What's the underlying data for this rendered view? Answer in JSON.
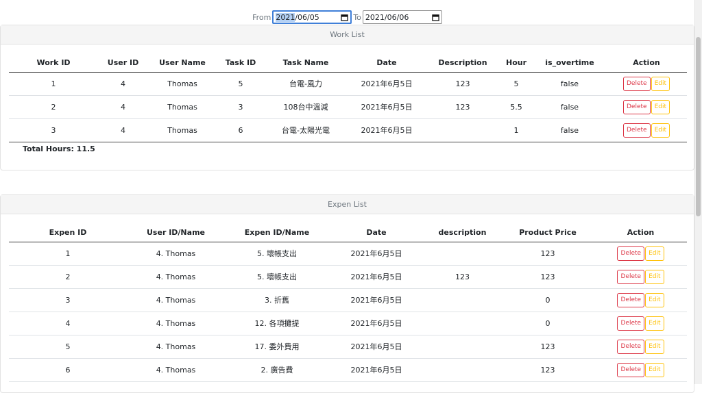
{
  "date_filter": {
    "from_label": "From",
    "from_value": "2021/06/05",
    "to_label": "To",
    "to_value": "2021/06/06"
  },
  "work_list": {
    "title": "Work List",
    "columns": [
      "Work ID",
      "User ID",
      "User Name",
      "Task ID",
      "Task Name",
      "Date",
      "Description",
      "Hour",
      "is_overtime",
      "Action"
    ],
    "rows": [
      {
        "work_id": "1",
        "user_id": "4",
        "user_name": "Thomas",
        "task_id": "5",
        "task_name": "台電-風力",
        "date": "2021年6月5日",
        "description": "123",
        "hour": "5",
        "is_overtime": "false"
      },
      {
        "work_id": "2",
        "user_id": "4",
        "user_name": "Thomas",
        "task_id": "3",
        "task_name": "108台中溫減",
        "date": "2021年6月5日",
        "description": "123",
        "hour": "5.5",
        "is_overtime": "false"
      },
      {
        "work_id": "3",
        "user_id": "4",
        "user_name": "Thomas",
        "task_id": "6",
        "task_name": "台電-太陽光電",
        "date": "2021年6月5日",
        "description": "",
        "hour": "1",
        "is_overtime": "false"
      }
    ],
    "total_hours": "Total Hours: 11.5"
  },
  "expen_list": {
    "title": "Expen List",
    "columns": [
      "Expen ID",
      "User ID/Name",
      "Expen ID/Name",
      "Date",
      "description",
      "Product Price",
      "Action"
    ],
    "rows": [
      {
        "expen_id": "1",
        "user": "4. Thomas",
        "expen": "5. 壞帳支出",
        "date": "2021年6月5日",
        "description": "",
        "price": "123"
      },
      {
        "expen_id": "2",
        "user": "4. Thomas",
        "expen": "5. 壞帳支出",
        "date": "2021年6月5日",
        "description": "123",
        "price": "123"
      },
      {
        "expen_id": "3",
        "user": "4. Thomas",
        "expen": "3. 折舊",
        "date": "2021年6月5日",
        "description": "",
        "price": "0"
      },
      {
        "expen_id": "4",
        "user": "4. Thomas",
        "expen": "12. 各項攤提",
        "date": "2021年6月5日",
        "description": "",
        "price": "0"
      },
      {
        "expen_id": "5",
        "user": "4. Thomas",
        "expen": "17. 委外費用",
        "date": "2021年6月5日",
        "description": "",
        "price": "123"
      },
      {
        "expen_id": "6",
        "user": "4. Thomas",
        "expen": "2. 廣告費",
        "date": "2021年6月5日",
        "description": "",
        "price": "123"
      }
    ]
  },
  "actions": {
    "delete_label": "Delete",
    "edit_label": "Edit"
  },
  "colors": {
    "delete": "#dc3545",
    "edit": "#ffc107",
    "date_focus": "#3f7fd8"
  },
  "icons": {
    "calendar": "calendar-icon"
  }
}
